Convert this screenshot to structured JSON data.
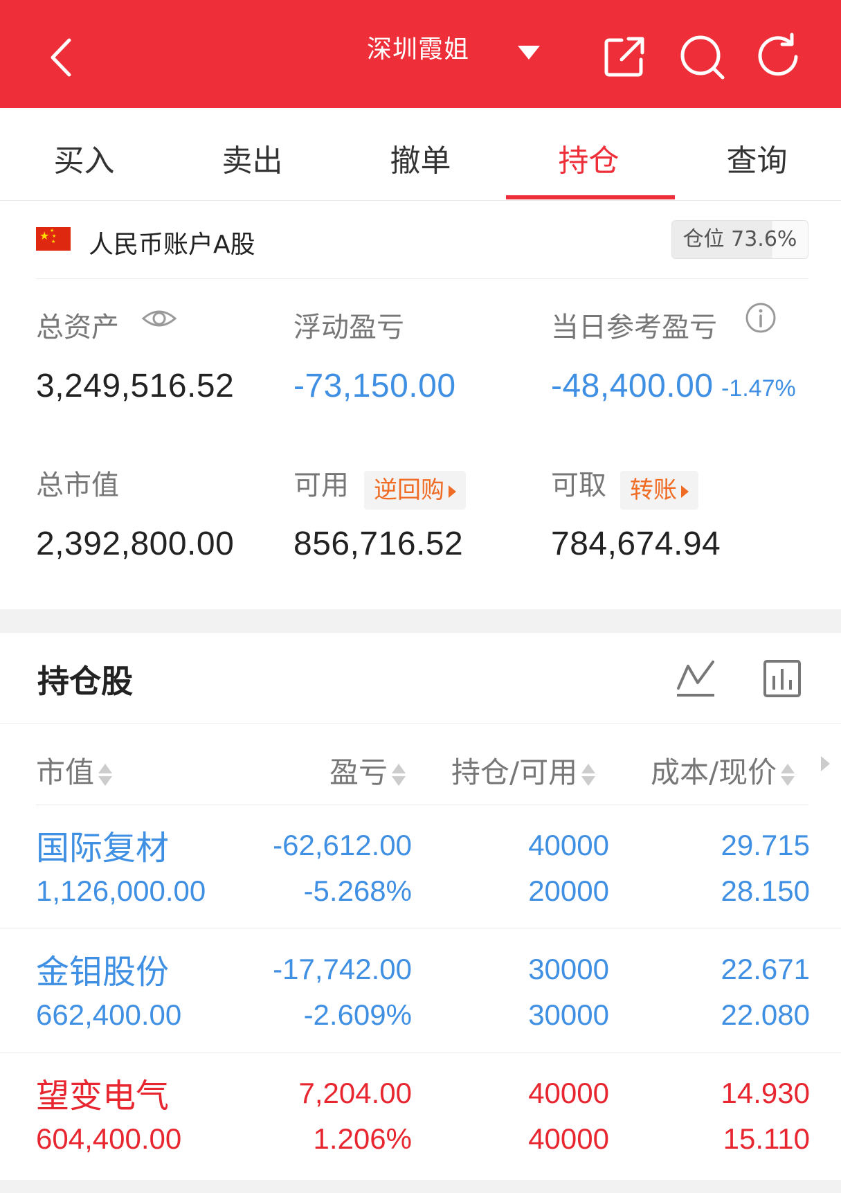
{
  "header": {
    "title": "深圳霞姐",
    "bg_color": "#ee2e38",
    "icons": [
      "back-arrow-icon",
      "dropdown-triangle-icon",
      "share-external-icon",
      "search-icon",
      "refresh-icon"
    ]
  },
  "tabs": [
    {
      "label": "买入",
      "active": false
    },
    {
      "label": "卖出",
      "active": false
    },
    {
      "label": "撤单",
      "active": false
    },
    {
      "label": "持仓",
      "active": true
    },
    {
      "label": "查询",
      "active": false
    }
  ],
  "account": {
    "name": "人民币账户A股",
    "position_label": "仓位",
    "position_value": "73.6%",
    "position_fraction": 0.736,
    "total_assets_label": "总资产",
    "total_assets": "3,249,516.52",
    "floating_pl_label": "浮动盈亏",
    "floating_pl": "-73,150.00",
    "daily_pl_label": "当日参考盈亏",
    "daily_pl": "-48,400.00",
    "daily_pl_pct": "-1.47%",
    "market_value_label": "总市值",
    "market_value": "2,392,800.00",
    "available_label": "可用",
    "available_tag": "逆回购",
    "available": "856,716.52",
    "withdrawable_label": "可取",
    "withdrawable_tag": "转账",
    "withdrawable": "784,674.94"
  },
  "holdings": {
    "title": "持仓股",
    "columns": {
      "market_value": "市值",
      "pl": "盈亏",
      "qty": "持仓/可用",
      "cost": "成本/现价"
    },
    "rows": [
      {
        "name": "国际复材",
        "market_value": "1,126,000.00",
        "pl": "-62,612.00",
        "pl_pct": "-5.268%",
        "hold": "40000",
        "avail": "20000",
        "cost": "29.715",
        "price": "28.150",
        "trend": "down"
      },
      {
        "name": "金钼股份",
        "market_value": "662,400.00",
        "pl": "-17,742.00",
        "pl_pct": "-2.609%",
        "hold": "30000",
        "avail": "30000",
        "cost": "22.671",
        "price": "22.080",
        "trend": "down"
      },
      {
        "name": "望变电气",
        "market_value": "604,400.00",
        "pl": "7,204.00",
        "pl_pct": "1.206%",
        "hold": "40000",
        "avail": "40000",
        "cost": "14.930",
        "price": "15.110",
        "trend": "up"
      }
    ]
  }
}
